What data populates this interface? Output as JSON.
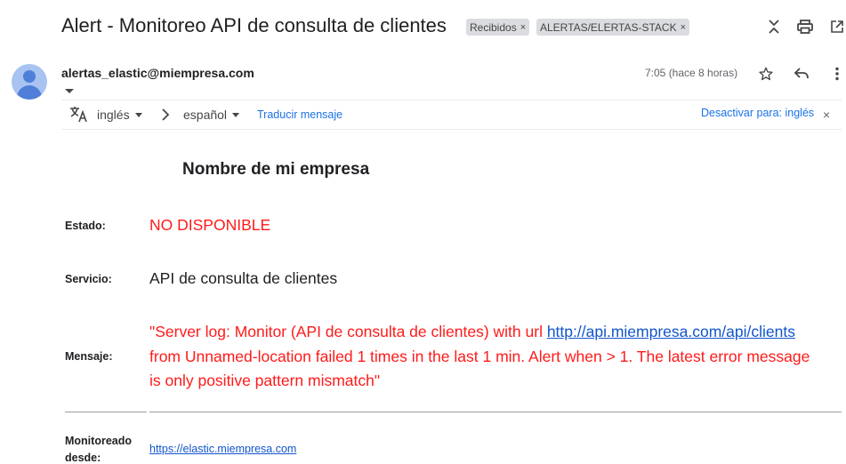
{
  "header": {
    "subject": "Alert - Monitoreo API de consulta de clientes",
    "labels": [
      {
        "name": "Recibidos"
      },
      {
        "name": "ALERTAS/ELERTAS-STACK"
      }
    ],
    "actions": [
      "collapse-icon",
      "print-icon",
      "open-new-window-icon"
    ]
  },
  "message_header": {
    "sender": "alertas_elastic@miempresa.com",
    "time": "7:05 (hace 8 horas)",
    "actions": [
      "star-icon",
      "reply-icon",
      "more-vert-icon"
    ]
  },
  "translate_bar": {
    "from_language": "inglés",
    "to_language": "español",
    "translate_link": "Traducir mensaje",
    "disable_link": "Desactivar para: inglés",
    "disable_close": "×"
  },
  "email": {
    "company": "Nombre de mi empresa",
    "fields": [
      {
        "label": "Estado:",
        "value": "NO DISPONIBLE"
      },
      {
        "label": "Servicio:",
        "value": "API de consulta de clientes"
      },
      {
        "label": "Mensaje:",
        "value_line1_prefix": "\"Server log: Monitor (API de consulta de clientes) with url ",
        "value_link": "http://api.miempresa.com/api/clients",
        "value_line2": "from Unnamed-location failed 1 times in the last 1 min. Alert when > 1. The latest error message",
        "value_line3": "is only positive pattern mismatch\""
      },
      {
        "label_line1": "Monitoreado",
        "label_line2": "desde:",
        "value": "https://elastic.miempresa.com"
      }
    ]
  },
  "colors": {
    "alert_red": "#ff1a1a",
    "link_blue": "#1155cc",
    "ui_blue": "#1a73e8",
    "chip_gray": "#dadce0"
  }
}
